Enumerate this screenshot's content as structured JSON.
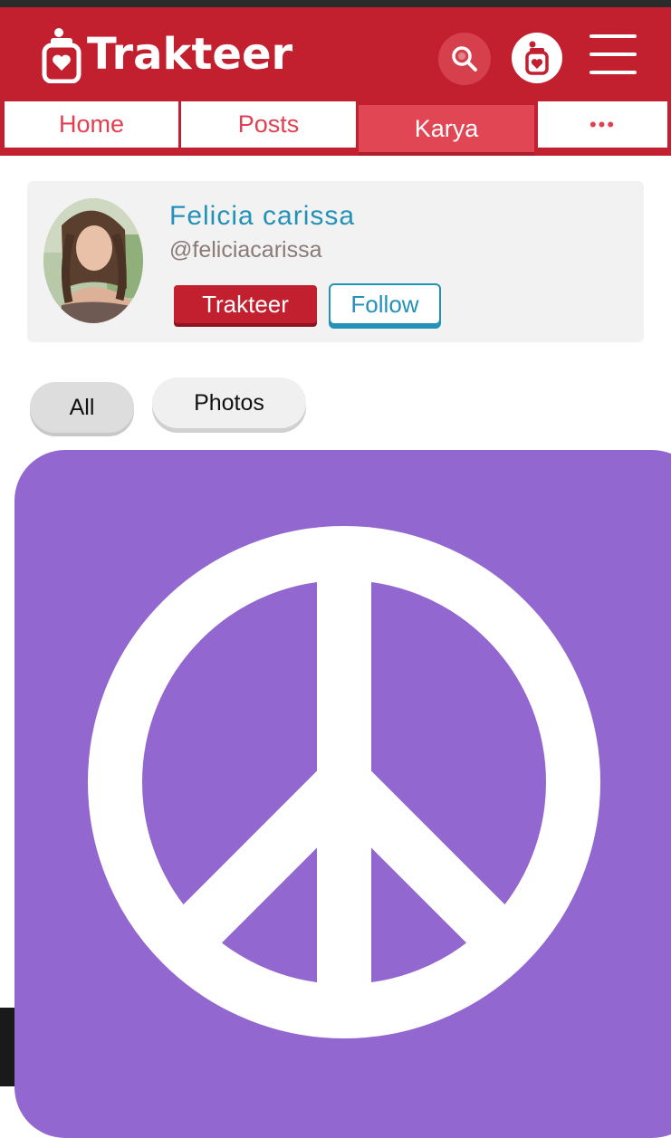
{
  "header": {
    "brand": "Trakteer",
    "colors": {
      "brand_red": "#c21f2f",
      "accent_blue": "#2391b8",
      "media_purple": "#9267cf"
    },
    "icons": [
      "jar-logo-icon",
      "search-icon",
      "jar-icon",
      "hamburger-menu-icon"
    ]
  },
  "tabs": [
    {
      "label": "Home",
      "active": false
    },
    {
      "label": "Posts",
      "active": false
    },
    {
      "label": "Karya",
      "active": true
    },
    {
      "label": "•••",
      "active": false
    }
  ],
  "profile": {
    "name": "Felicia carissa",
    "handle": "@feliciacarissa",
    "trakteer_label": "Trakteer",
    "follow_label": "Follow"
  },
  "filters": [
    {
      "label": "All",
      "selected": true
    },
    {
      "label": "Photos",
      "selected": false
    }
  ],
  "media": {
    "icon": "peace-symbol-icon"
  }
}
